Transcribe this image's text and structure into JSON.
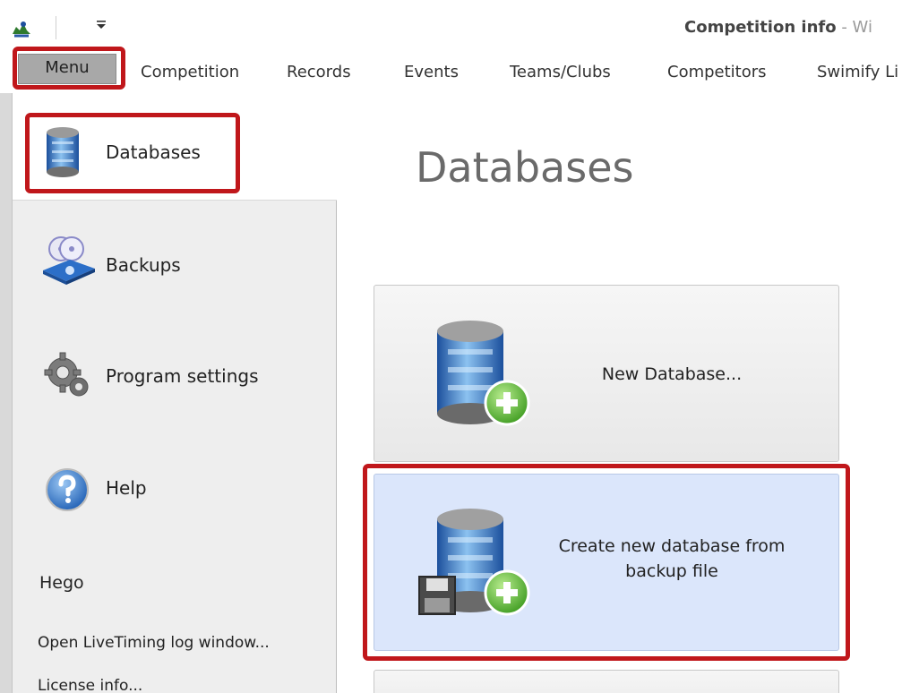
{
  "window": {
    "title_bold": "Competition info",
    "title_rest": " - Wi"
  },
  "ribbon": {
    "menu_label": "Menu",
    "tabs": [
      "Competition",
      "Records",
      "Events",
      "Teams/Clubs",
      "Competitors",
      "Swimify Li"
    ],
    "quick_access_icon": "chevron-down-icon"
  },
  "sidebar": {
    "items": [
      {
        "label": "Databases",
        "icon": "database-icon",
        "selected": true
      },
      {
        "label": "Backups",
        "icon": "backup-discs-icon"
      },
      {
        "label": "Program settings",
        "icon": "gears-icon"
      },
      {
        "label": "Help",
        "icon": "help-icon"
      }
    ],
    "section_label": "Hego",
    "links": [
      "Open LiveTiming log window...",
      "License info..."
    ]
  },
  "main": {
    "title": "Databases",
    "cards": [
      {
        "label": "New Database...",
        "icon": "database-add-icon"
      },
      {
        "label": "Create new database from backup file",
        "icon": "database-from-backup-icon"
      },
      {
        "label": "",
        "icon": ""
      }
    ]
  },
  "colors": {
    "highlight": "#c0171b",
    "selected_card": "#dbe6fb",
    "menu_tab": "#a8a8a8"
  }
}
